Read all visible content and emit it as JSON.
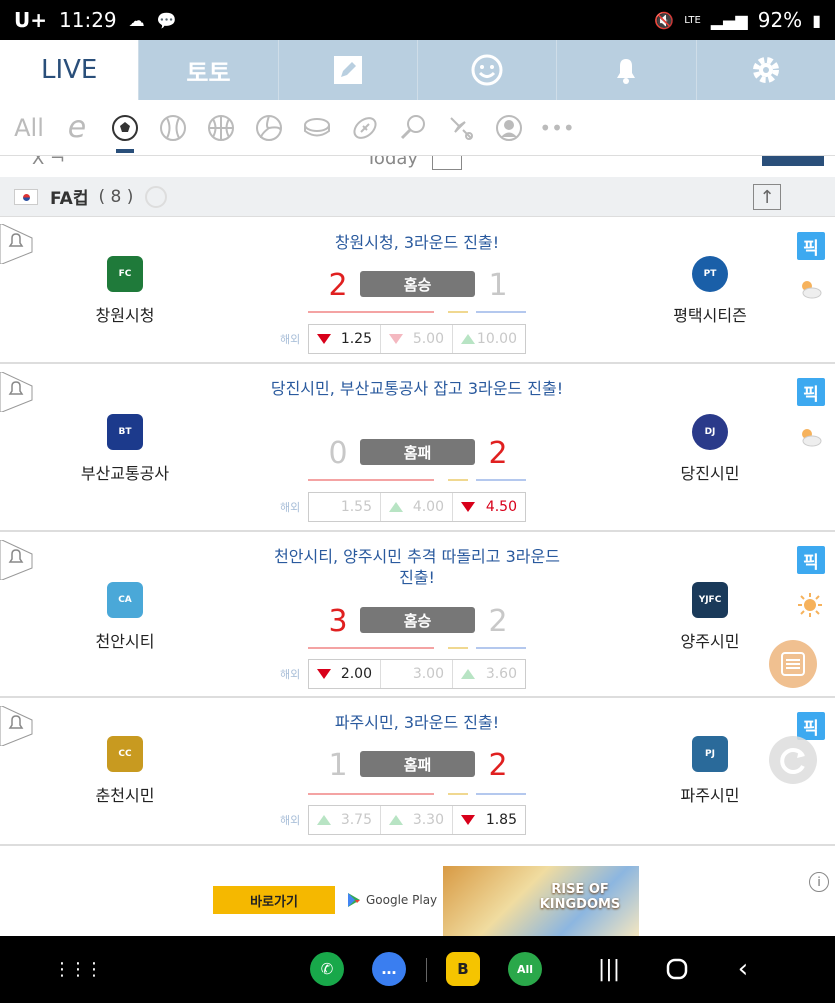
{
  "status": {
    "carrier": "U+",
    "time": "11:29",
    "battery": "92%",
    "network": "LTE"
  },
  "tabs": {
    "live": "LIVE",
    "toto": "토토"
  },
  "sports": {
    "all": "All",
    "esports": "e"
  },
  "subbar": {
    "left": "X ¬",
    "center": "Today"
  },
  "league": {
    "name": "FA컵",
    "count": "( 8 )"
  },
  "odds_label": "해외",
  "pick_label": "픽",
  "matches": [
    {
      "headline": "창원시청, 3라운드 진출!",
      "home": {
        "name": "창원시청",
        "score": "2"
      },
      "away": {
        "name": "평택시티즌",
        "score": "1"
      },
      "result": "홈승",
      "odds": [
        "1.25",
        "5.00",
        "10.00"
      ]
    },
    {
      "headline": "당진시민, 부산교통공사 잡고 3라운드 진출!",
      "home": {
        "name": "부산교통공사",
        "score": "0"
      },
      "away": {
        "name": "당진시민",
        "score": "2"
      },
      "result": "홈패",
      "odds": [
        "1.55",
        "4.00",
        "4.50"
      ]
    },
    {
      "headline": "천안시티, 양주시민 추격 따돌리고 3라운드 진출!",
      "home": {
        "name": "천안시티",
        "score": "3"
      },
      "away": {
        "name": "양주시민",
        "score": "2"
      },
      "result": "홈승",
      "odds": [
        "2.00",
        "3.00",
        "3.60"
      ]
    },
    {
      "headline": "파주시민, 3라운드 진출!",
      "home": {
        "name": "춘천시민",
        "score": "1"
      },
      "away": {
        "name": "파주시민",
        "score": "2"
      },
      "result": "홈패",
      "odds": [
        "3.75",
        "3.30",
        "1.85"
      ]
    }
  ],
  "ad": {
    "button": "바로가기",
    "store": "Google Play",
    "game_title": "RISE OF KINGDOMS"
  },
  "colors": {
    "accent": "#2a4f7a",
    "win": "#e02020",
    "pick": "#3da9f0"
  }
}
